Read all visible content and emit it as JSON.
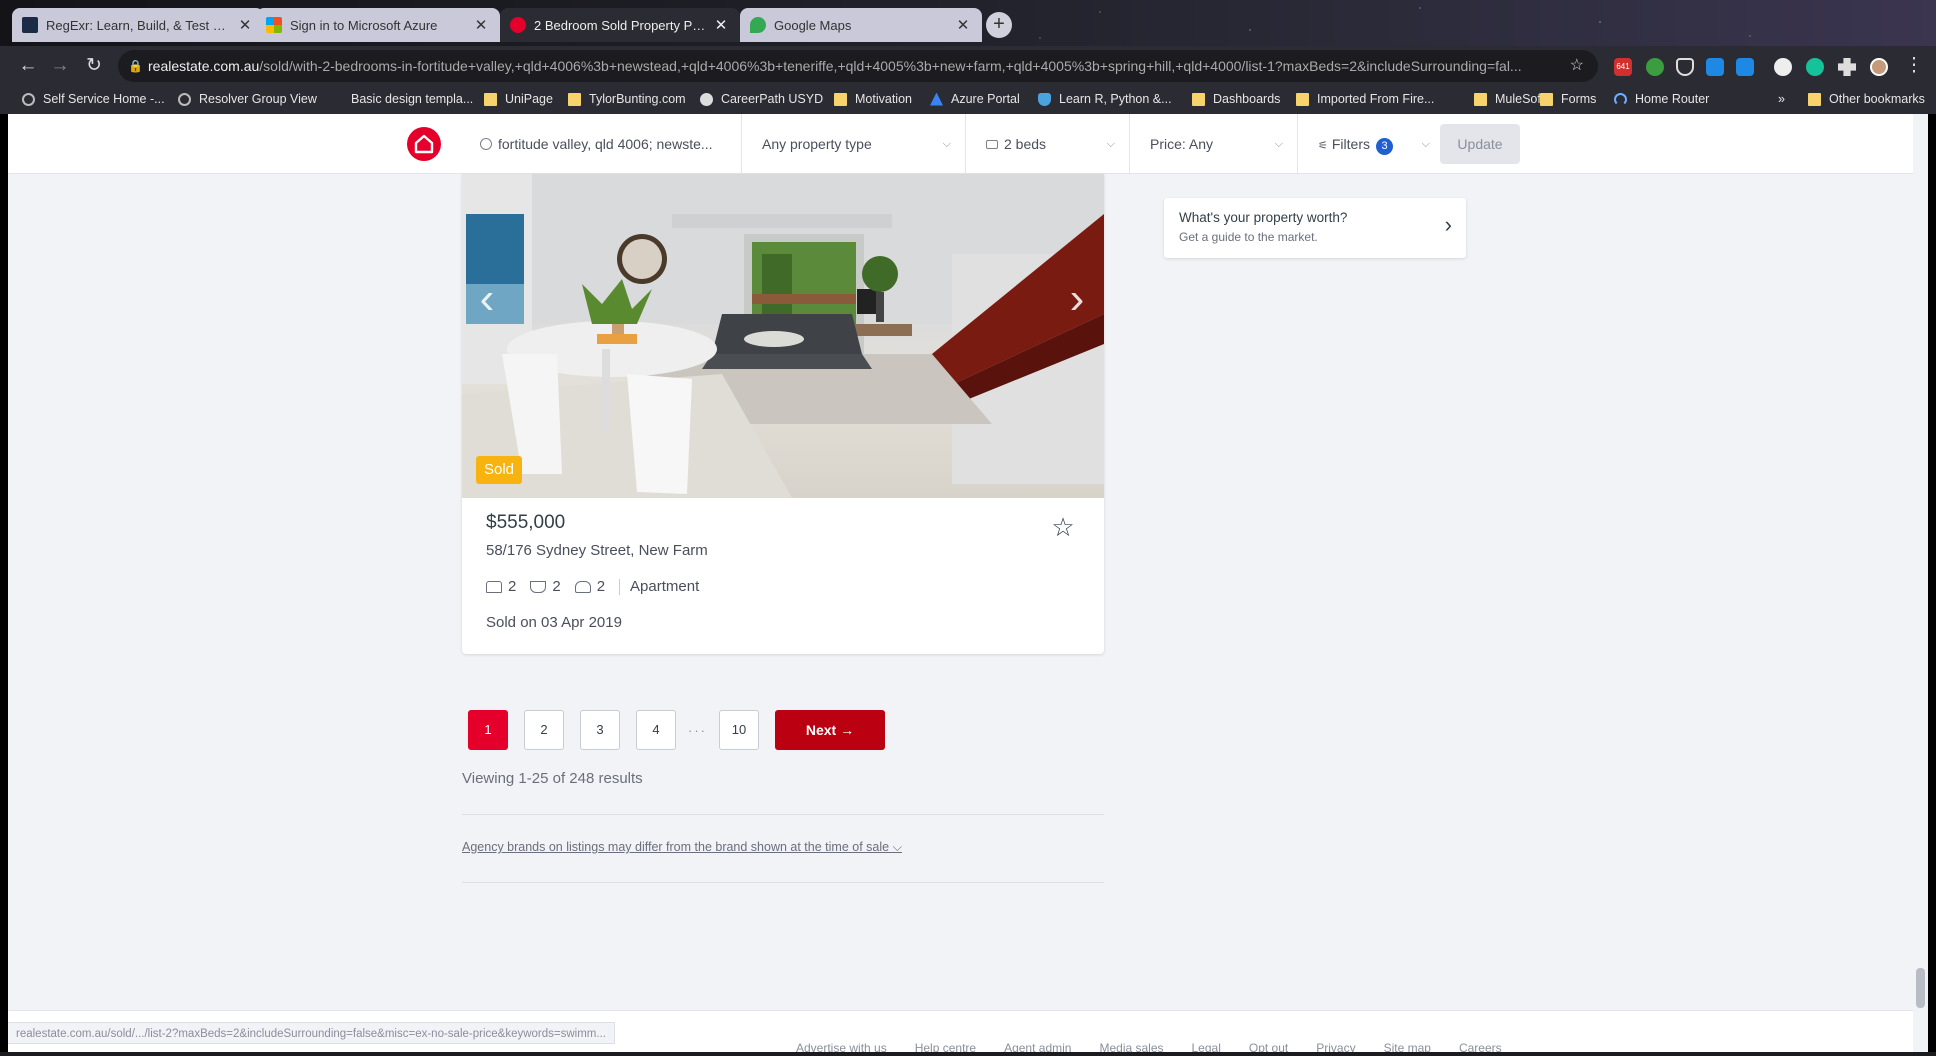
{
  "browser": {
    "tabs": [
      {
        "title": "RegExr: Learn, Build, & Test RegE",
        "active": false,
        "favicon_color": "#1b2b45"
      },
      {
        "title": "Sign in to Microsoft Azure",
        "active": false,
        "favicon_color": "#f25022"
      },
      {
        "title": "2 Bedroom Sold Property Prices",
        "active": true,
        "favicon_color": "#e4002b"
      },
      {
        "title": "Google Maps",
        "active": false,
        "favicon_color": "#34a853"
      }
    ],
    "url_host": "realestate.com.au",
    "url_path": "/sold/with-2-bedrooms-in-fortitude+valley,+qld+4006%3b+newstead,+qld+4006%3b+teneriffe,+qld+4005%3b+new+farm,+qld+4005%3b+spring+hill,+qld+4000/list-1?maxBeds=2&includeSurrounding=fal...",
    "extension_badge": "641",
    "bookmarks": [
      "Self Service Home -...",
      "Resolver Group View",
      "Basic design templa...",
      "UniPage",
      "TylorBunting.com",
      "CareerPath USYD",
      "Motivation",
      "Azure Portal",
      "Learn R, Python &...",
      "Dashboards",
      "Imported From Fire...",
      "MuleSoft",
      "Forms",
      "Home Router"
    ],
    "bookmarks_overflow": "»",
    "other_bookmarks": "Other bookmarks"
  },
  "search_bar": {
    "location": "fortitude valley, qld 4006; newste...",
    "property_type": "Any property type",
    "beds": "2 beds",
    "price": "Price: Any",
    "filters_label": "Filters",
    "filters_count": "3",
    "update_label": "Update"
  },
  "listing": {
    "tag": "Sold",
    "price": "$555,000",
    "address": "58/176 Sydney Street, New Farm",
    "bedrooms": "2",
    "bathrooms": "2",
    "parking": "2",
    "property_type": "Apartment",
    "sold_date": "Sold on 03 Apr 2019"
  },
  "sidebar": {
    "worth_title": "What's your property worth?",
    "worth_subtitle": "Get a guide to the market."
  },
  "pagination": {
    "pages": [
      "1",
      "2",
      "3",
      "4"
    ],
    "ellipsis": "···",
    "last_page": "10",
    "current": "1",
    "next_label": "Next →",
    "results_text": "Viewing 1-25 of 248 results"
  },
  "agency_note": "Agency brands on listings may differ from the brand shown at the time of sale",
  "footer_links": [
    "Advertise with us",
    "Help centre",
    "Agent admin",
    "Media sales",
    "Legal",
    "Opt out",
    "Privacy",
    "Site map",
    "Careers"
  ],
  "status_url": "realestate.com.au/sold/.../list-2?maxBeds=2&includeSurrounding=false&misc=ex-no-sale-price&keywords=swimm..."
}
